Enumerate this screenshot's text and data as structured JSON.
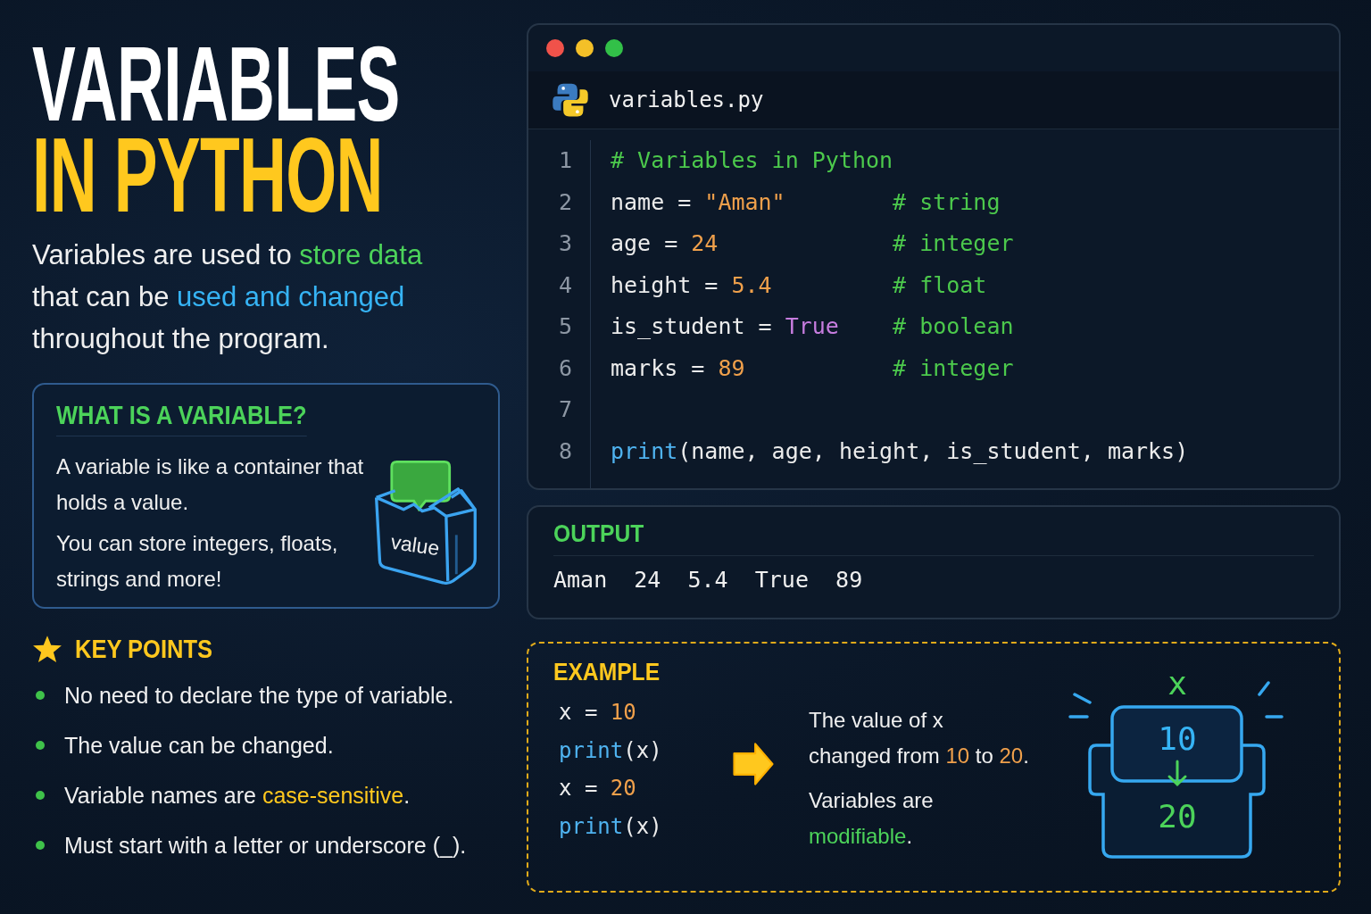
{
  "title": {
    "line_1": "VARIABLES",
    "line_2": "IN PYTHON"
  },
  "intro": [
    {
      "text": "Variables are used to "
    },
    {
      "text": "store data",
      "color": "#4cd35a"
    },
    {
      "text": " that can be "
    },
    {
      "text": "used and changed",
      "color": "#36b4f5"
    },
    {
      "text": " throughout the program."
    }
  ],
  "definition_card": {
    "heading": "WHAT IS A VARIABLE?",
    "paragraphs": [
      "A variable is like a container that holds a value.",
      "You can store integers, floats, strings and more!"
    ],
    "illustration_label": "value"
  },
  "key_points": {
    "heading": "KEY POINTS",
    "items": [
      [
        {
          "text": "No need to declare the type of variable."
        }
      ],
      [
        {
          "text": "The value can be changed."
        }
      ],
      [
        {
          "text": "Variable names are "
        },
        {
          "text": "case-sensitive",
          "color": "#ffc81e"
        },
        {
          "text": "."
        }
      ],
      [
        {
          "text": "Must start with a letter or underscore (_)."
        }
      ]
    ]
  },
  "editor": {
    "filename": "variables.py",
    "lines": [
      {
        "number": "1",
        "tokens": [
          {
            "text": "# Variables in Python",
            "kind": "comment"
          }
        ]
      },
      {
        "number": "2",
        "tokens": [
          {
            "text": "name = ",
            "kind": "plain"
          },
          {
            "text": "\"Aman\"",
            "kind": "string"
          }
        ],
        "comment": "# string"
      },
      {
        "number": "3",
        "tokens": [
          {
            "text": "age = ",
            "kind": "plain"
          },
          {
            "text": "24",
            "kind": "number"
          }
        ],
        "comment": "# integer"
      },
      {
        "number": "4",
        "tokens": [
          {
            "text": "height = ",
            "kind": "plain"
          },
          {
            "text": "5.4",
            "kind": "number"
          }
        ],
        "comment": "# float"
      },
      {
        "number": "5",
        "tokens": [
          {
            "text": "is_student = ",
            "kind": "plain"
          },
          {
            "text": "True",
            "kind": "keyword"
          }
        ],
        "comment": "# boolean"
      },
      {
        "number": "6",
        "tokens": [
          {
            "text": "marks = ",
            "kind": "plain"
          },
          {
            "text": "89",
            "kind": "number"
          }
        ],
        "comment": "# integer"
      },
      {
        "number": "7"
      },
      {
        "number": "8",
        "tokens": [
          {
            "text": "print",
            "kind": "function"
          },
          {
            "text": "(name, age, height, is_student, marks)",
            "kind": "plain"
          }
        ]
      }
    ]
  },
  "output": {
    "heading": "OUTPUT",
    "text": "Aman  24  5.4  True  89"
  },
  "example": {
    "heading": "EXAMPLE",
    "code": [
      [
        {
          "text": "x = ",
          "kind": "plain"
        },
        {
          "text": "10",
          "kind": "number"
        }
      ],
      [
        {
          "text": "print",
          "kind": "function"
        },
        {
          "text": "(x)",
          "kind": "plain"
        }
      ],
      [
        {
          "text": "x = ",
          "kind": "plain"
        },
        {
          "text": "20",
          "kind": "number"
        }
      ],
      [
        {
          "text": "print",
          "kind": "function"
        },
        {
          "text": "(x)",
          "kind": "plain"
        }
      ]
    ],
    "explanation": [
      [
        [
          {
            "text": "The value of x"
          }
        ],
        [
          {
            "text": "changed from "
          },
          {
            "text": "10",
            "color": "#f0a04b"
          },
          {
            "text": " to "
          },
          {
            "text": "20",
            "color": "#f0a04b"
          },
          {
            "text": "."
          }
        ]
      ],
      [
        [
          {
            "text": "Variables are"
          }
        ],
        [
          {
            "text": "modifiable",
            "color": "#4cd35a"
          },
          {
            "text": "."
          }
        ]
      ]
    ],
    "diagram": {
      "name": "x",
      "old_value": "10",
      "new_value": "20"
    }
  }
}
